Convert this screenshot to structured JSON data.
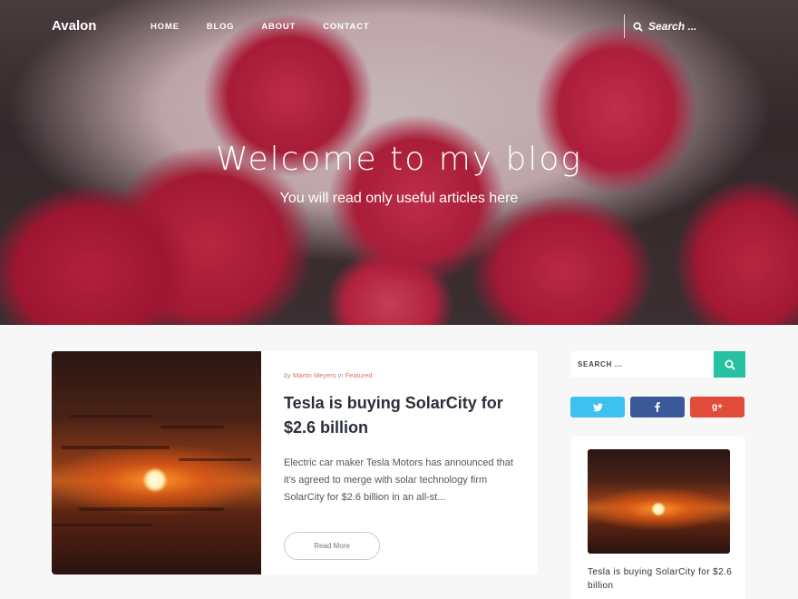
{
  "site": {
    "logo": "Avalon"
  },
  "nav": {
    "items": [
      "HOME",
      "BLOG",
      "ABOUT",
      "CONTACT"
    ]
  },
  "search": {
    "placeholder": "Search ..."
  },
  "hero": {
    "title": "Welcome to my blog",
    "subtitle": "You will read only useful articles here"
  },
  "post": {
    "meta_by": "by",
    "author": "Martin Meyers",
    "meta_in": "in",
    "category": "Featured",
    "title": "Tesla is buying SolarCity for $2.6 billion",
    "excerpt": "Electric car maker Tesla Motors has announced that it’s agreed to merge with solar technology firm SolarCity for $2.6 billion in an all-st...",
    "read_more": "Read More"
  },
  "sidebar": {
    "search_placeholder": "SEARCH ...",
    "social": {
      "twitter": "twitter-icon",
      "facebook": "facebook-icon",
      "googleplus": "google-plus-icon"
    },
    "widget_title": "Tesla is buying SolarCity for $2.6 billion"
  },
  "colors": {
    "accent": "#27c0a0",
    "twitter": "#3fc1f0",
    "facebook": "#3b5998",
    "googleplus": "#e04b3a",
    "meta_link": "#e0735a"
  }
}
